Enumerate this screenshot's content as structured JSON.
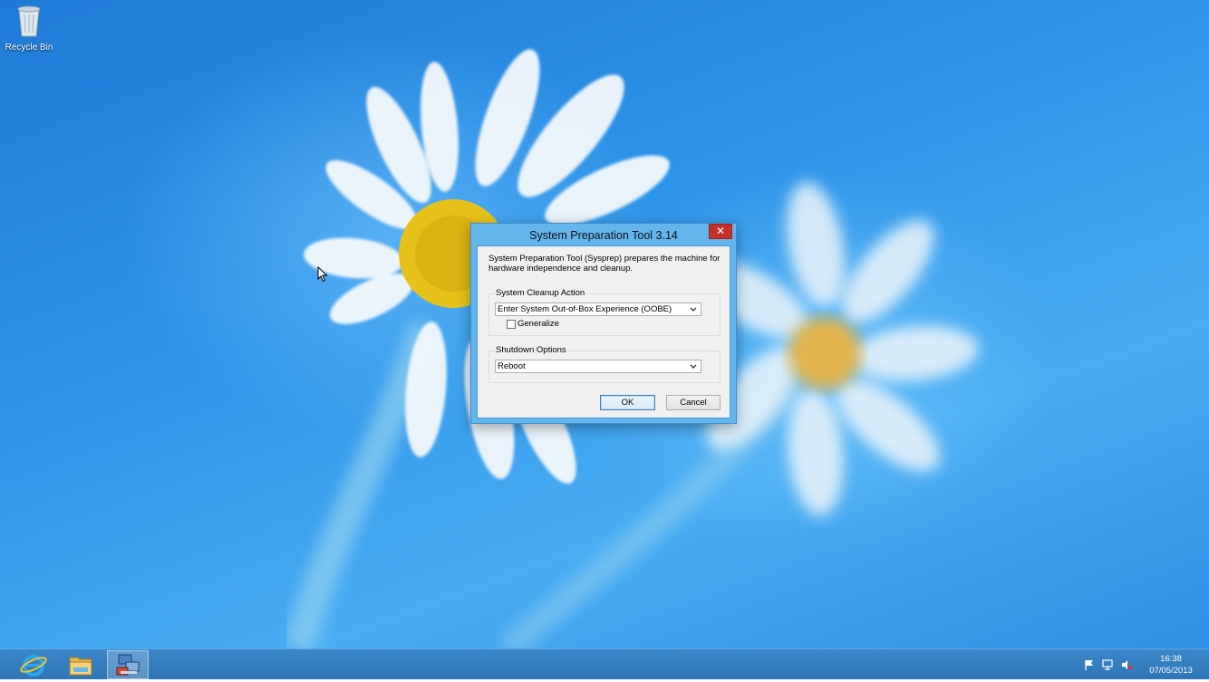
{
  "desktop": {
    "icons": [
      {
        "label": "Recycle Bin",
        "icon": "recycle-bin-icon"
      }
    ]
  },
  "dialog": {
    "title": "System Preparation Tool 3.14",
    "close_glyph": "✕",
    "description": "System Preparation Tool (Sysprep) prepares the machine for hardware independence and cleanup.",
    "cleanup_group": {
      "label": "System Cleanup Action",
      "selected": "Enter System Out-of-Box Experience (OOBE)",
      "generalize_label": "Generalize",
      "generalize_checked": false
    },
    "shutdown_group": {
      "label": "Shutdown Options",
      "selected": "Reboot"
    },
    "ok_label": "OK",
    "cancel_label": "Cancel"
  },
  "taskbar": {
    "items": [
      {
        "name": "internet-explorer",
        "icon": "internet-explorer-icon"
      },
      {
        "name": "file-explorer",
        "icon": "folder-icon"
      },
      {
        "name": "sysprep",
        "icon": "sysprep-icon",
        "active": true
      }
    ],
    "tray": [
      "action-center-flag-icon",
      "network-icon",
      "volume-muted-icon"
    ],
    "clock": {
      "time": "16:38",
      "date": "07/05/2013"
    }
  },
  "colors": {
    "desktop_blue": "#2e95ea",
    "taskbar": "#3379bb",
    "close_red": "#c7312b",
    "dialog_frame": "#64b5ec"
  }
}
